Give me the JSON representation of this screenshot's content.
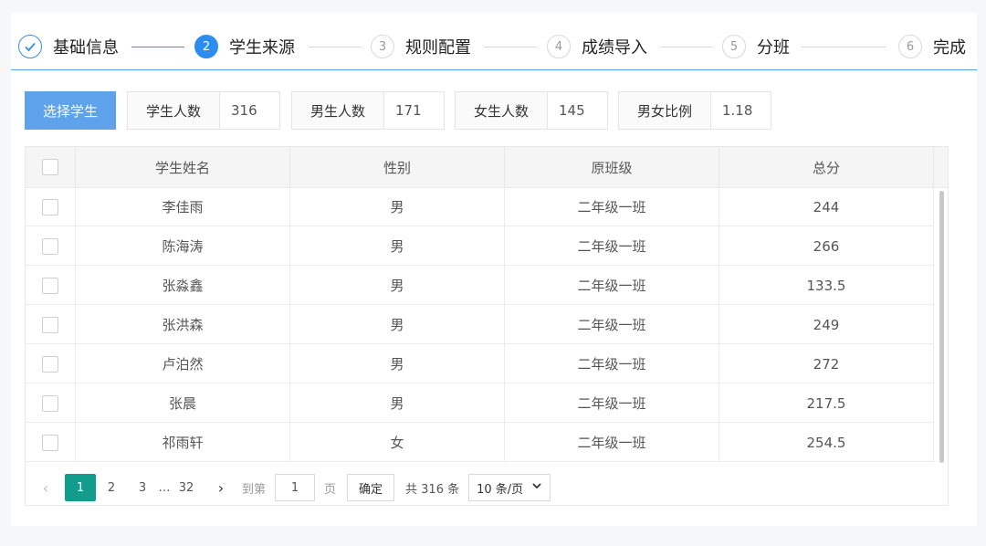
{
  "steps": [
    {
      "num": "",
      "label": "基础信息",
      "state": "done"
    },
    {
      "num": "2",
      "label": "学生来源",
      "state": "active"
    },
    {
      "num": "3",
      "label": "规则配置",
      "state": "todo"
    },
    {
      "num": "4",
      "label": "成绩导入",
      "state": "todo"
    },
    {
      "num": "5",
      "label": "分班",
      "state": "todo"
    },
    {
      "num": "6",
      "label": "完成",
      "state": "todo"
    }
  ],
  "toolbar": {
    "select_button": "选择学生",
    "stats": [
      {
        "label": "学生人数",
        "value": "316"
      },
      {
        "label": "男生人数",
        "value": "171"
      },
      {
        "label": "女生人数",
        "value": "145"
      },
      {
        "label": "男女比例",
        "value": "1.18"
      }
    ]
  },
  "table": {
    "columns": [
      "学生姓名",
      "性别",
      "原班级",
      "总分"
    ],
    "rows": [
      [
        "李佳雨",
        "男",
        "二年级一班",
        "244"
      ],
      [
        "陈海涛",
        "男",
        "二年级一班",
        "266"
      ],
      [
        "张淼鑫",
        "男",
        "二年级一班",
        "133.5"
      ],
      [
        "张洪森",
        "男",
        "二年级一班",
        "249"
      ],
      [
        "卢泊然",
        "男",
        "二年级一班",
        "272"
      ],
      [
        "张晨",
        "男",
        "二年级一班",
        "217.5"
      ],
      [
        "祁雨轩",
        "女",
        "二年级一班",
        "254.5"
      ]
    ]
  },
  "pagination": {
    "prev": "‹",
    "pages": [
      "1",
      "2",
      "3"
    ],
    "ellipsis": "…",
    "last_page": "32",
    "next": "›",
    "goto_label": "到第",
    "goto_value": "1",
    "page_suffix": "页",
    "confirm": "确定",
    "total": "共 316 条",
    "page_size": "10 条/页"
  },
  "colors": {
    "primary": "#2d8cf0",
    "button": "#5ea2ec",
    "active_page": "#129c8c"
  }
}
